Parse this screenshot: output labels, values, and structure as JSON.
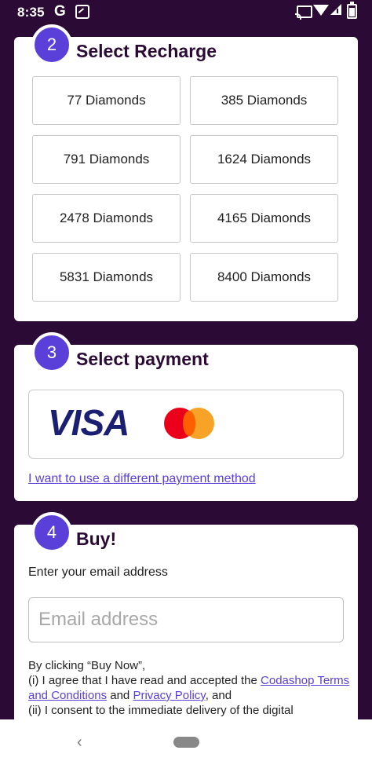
{
  "status_bar": {
    "time": "8:35",
    "g_label": "G",
    "icons": [
      "photo-icon",
      "cast-icon",
      "wifi-icon",
      "signal-icon",
      "battery-icon"
    ]
  },
  "recharge": {
    "step": "2",
    "title": "Select Recharge",
    "options": [
      "77 Diamonds",
      "385 Diamonds",
      "791 Diamonds",
      "1624 Diamonds",
      "2478 Diamonds",
      "4165 Diamonds",
      "5831 Diamonds",
      "8400 Diamonds"
    ]
  },
  "payment": {
    "step": "3",
    "title": "Select payment",
    "visa_label": "VISA",
    "other_method_link": "I want to use a different payment method"
  },
  "buy": {
    "step": "4",
    "title": "Buy!",
    "email_label": "Enter your email address",
    "email_placeholder": "Email address",
    "terms_intro": "By clicking “Buy Now”,",
    "terms_line1_pre": "(i) I agree that I have read and accepted the ",
    "terms_link1": "Codashop Terms and Conditions",
    "terms_and": " and ",
    "terms_link2": "Privacy Policy",
    "terms_line1_post": ", and",
    "terms_line2": "(ii) I consent to the immediate delivery of the digital"
  },
  "colors": {
    "background": "#2b0a35",
    "accent": "#5a3fd8",
    "card": "#ffffff"
  }
}
